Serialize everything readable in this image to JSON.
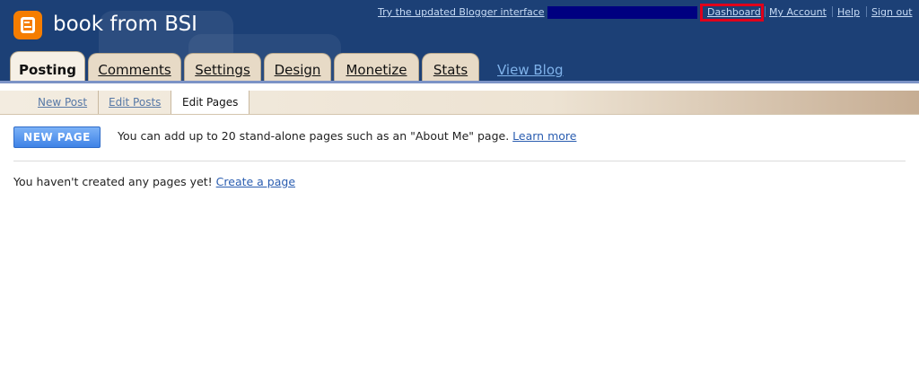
{
  "header": {
    "blog_title": "book from BSI",
    "logo_icon": "blogger-logo-icon",
    "brand_color": "#f57d00",
    "background_color": "#1c4076",
    "top_links": {
      "updated_interface": "Try the updated Blogger interface",
      "dashboard": "Dashboard",
      "my_account": "My Account",
      "help": "Help",
      "sign_out": "Sign out"
    }
  },
  "tabs": [
    {
      "label": "Posting",
      "active": true
    },
    {
      "label": "Comments"
    },
    {
      "label": "Settings"
    },
    {
      "label": "Design"
    },
    {
      "label": "Monetize"
    },
    {
      "label": "Stats"
    }
  ],
  "view_blog": "View Blog",
  "subnav": [
    {
      "label": "New Post"
    },
    {
      "label": "Edit Posts"
    },
    {
      "label": "Edit Pages",
      "active": true
    }
  ],
  "main": {
    "new_page_button": "NEW PAGE",
    "info_text": "You can add up to 20 stand-alone pages such as an \"About Me\" page.",
    "learn_more": "Learn more",
    "empty_text": "You haven't created any pages yet!",
    "create_page": "Create a page"
  }
}
